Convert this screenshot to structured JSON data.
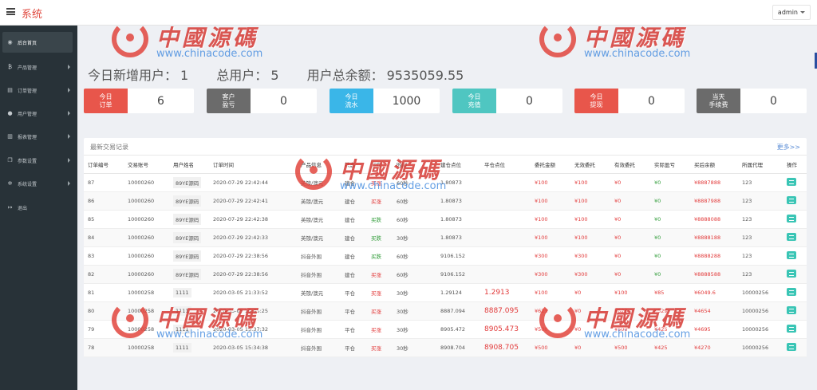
{
  "header": {
    "brand": "系统",
    "user": "admin"
  },
  "sidebar": {
    "items": [
      {
        "label": "后台首页",
        "icon": "dashboard-icon",
        "glyph": "◉"
      },
      {
        "label": "产品管理",
        "icon": "bitcoin-icon",
        "glyph": "₿"
      },
      {
        "label": "订单管理",
        "icon": "document-icon",
        "glyph": "▤"
      },
      {
        "label": "用户管理",
        "icon": "user-icon",
        "glyph": "●"
      },
      {
        "label": "报表管理",
        "icon": "clipboard-icon",
        "glyph": "▥"
      },
      {
        "label": "参数设置",
        "icon": "copy-icon",
        "glyph": "❐"
      },
      {
        "label": "系统设置",
        "icon": "gears-icon",
        "glyph": "✲"
      },
      {
        "label": "退出",
        "icon": "logout-icon",
        "glyph": "↦"
      }
    ]
  },
  "stats": {
    "new_users_label": "今日新增用户：",
    "new_users": "1",
    "total_users_label": "总用户：",
    "total_users": "5",
    "total_balance_label": "用户总余额：",
    "total_balance": "9535059.55"
  },
  "cards": [
    {
      "tag": "今日\n订单",
      "value": "6",
      "color": "#e8564b"
    },
    {
      "tag": "客户\n盈亏",
      "value": "0",
      "color": "#6b6b6b"
    },
    {
      "tag": "今日\n流水",
      "value": "1000",
      "color": "#3ab6e8"
    },
    {
      "tag": "今日\n充值",
      "value": "0",
      "color": "#4fc6c1"
    },
    {
      "tag": "今日\n提现",
      "value": "0",
      "color": "#e8564b"
    },
    {
      "tag": "当天\n手续费",
      "value": "0",
      "color": "#6b6b6b"
    }
  ],
  "trades": {
    "title": "最新交易记录",
    "more": "更多>>",
    "columns": [
      "订单编号",
      "交易账号",
      "用户姓名",
      "订单时间",
      "产品信息",
      "状态",
      "方向",
      "时间",
      "建仓点位",
      "平仓点位",
      "委托金额",
      "无效委托",
      "有效委托",
      "实际盈亏",
      "买后余额",
      "所属代理",
      "操作"
    ],
    "rows": [
      [
        "87",
        "10000260",
        "89YE源码",
        "2020-07-29 22:42:44",
        "英镑/澳元",
        "建仓",
        "买涨",
        "60秒",
        "1.80873",
        "",
        "¥100",
        "¥100",
        "¥0",
        "¥0",
        "¥8887888",
        "123"
      ],
      [
        "86",
        "10000260",
        "89YE源码",
        "2020-07-29 22:42:41",
        "英镑/澳元",
        "建仓",
        "买涨",
        "60秒",
        "1.80873",
        "",
        "¥100",
        "¥100",
        "¥0",
        "¥0",
        "¥8887988",
        "123"
      ],
      [
        "85",
        "10000260",
        "89YE源码",
        "2020-07-29 22:42:38",
        "英镑/澳元",
        "建仓",
        "买跌",
        "60秒",
        "1.80873",
        "",
        "¥100",
        "¥100",
        "¥0",
        "¥0",
        "¥8888088",
        "123"
      ],
      [
        "84",
        "10000260",
        "89YE源码",
        "2020-07-29 22:42:33",
        "英镑/澳元",
        "建仓",
        "买跌",
        "30秒",
        "1.80873",
        "",
        "¥100",
        "¥100",
        "¥0",
        "¥0",
        "¥8888188",
        "123"
      ],
      [
        "83",
        "10000260",
        "89YE源码",
        "2020-07-29 22:38:56",
        "抖音外围",
        "建仓",
        "买跌",
        "60秒",
        "9106.152",
        "",
        "¥300",
        "¥300",
        "¥0",
        "¥0",
        "¥8888288",
        "123"
      ],
      [
        "82",
        "10000260",
        "89YE源码",
        "2020-07-29 22:38:56",
        "抖音外围",
        "建仓",
        "买涨",
        "60秒",
        "9106.152",
        "",
        "¥300",
        "¥300",
        "¥0",
        "¥0",
        "¥8888588",
        "123"
      ],
      [
        "81",
        "10000258",
        "1111",
        "2020-03-05 21:33:52",
        "英镑/澳元",
        "平仓",
        "买涨",
        "30秒",
        "1.29124",
        "1.2913",
        "¥100",
        "¥0",
        "¥100",
        "¥85",
        "¥6049.6",
        "10000256"
      ],
      [
        "80",
        "10000258",
        "1111",
        "2020-03-05 15:45:25",
        "抖音外围",
        "平仓",
        "买涨",
        "30秒",
        "8887.094",
        "8887.095",
        "¥623",
        "¥0",
        "¥623",
        "¥529",
        "¥4654",
        "10000256"
      ],
      [
        "79",
        "10000258",
        "1111",
        "2020-03-05 15:37:32",
        "抖音外围",
        "平仓",
        "买涨",
        "30秒",
        "8905.472",
        "8905.473",
        "¥500",
        "¥0",
        "¥500",
        "¥425",
        "¥4695",
        "10000256"
      ],
      [
        "78",
        "10000258",
        "1111",
        "2020-03-05 15:34:38",
        "抖音外围",
        "平仓",
        "买涨",
        "30秒",
        "8908.704",
        "8908.705",
        "¥500",
        "¥0",
        "¥500",
        "¥425",
        "¥4270",
        "10000256"
      ]
    ]
  },
  "watermark": {
    "cn": "中國源碼",
    "url": "www.chinacode.com"
  }
}
